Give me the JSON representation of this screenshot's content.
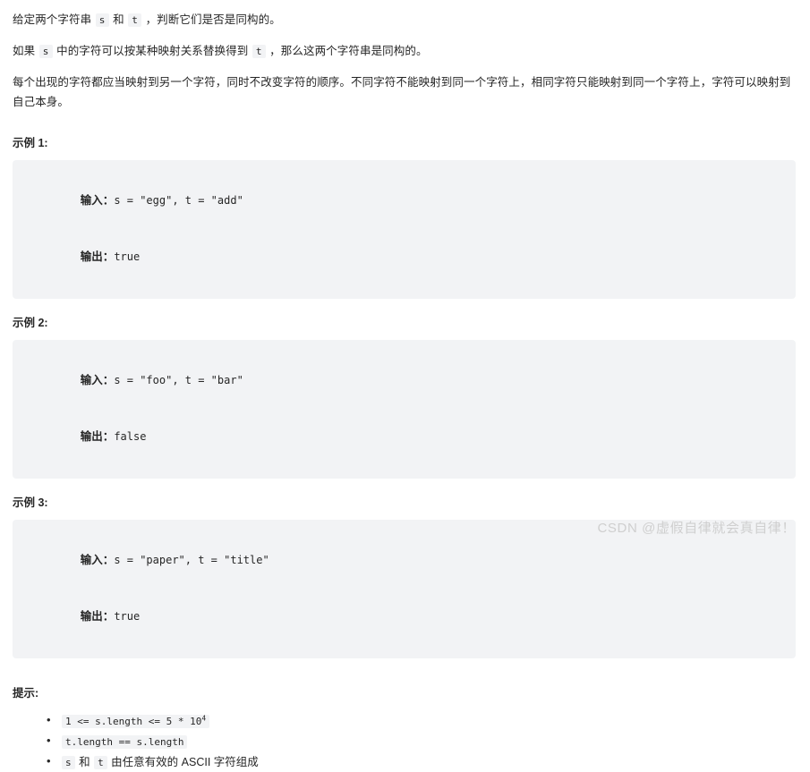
{
  "description": {
    "paragraphs": [
      {
        "parts": [
          {
            "type": "text",
            "value": "给定两个字符串 "
          },
          {
            "type": "code",
            "value": "s"
          },
          {
            "type": "text",
            "value": " 和 "
          },
          {
            "type": "code",
            "value": "t"
          },
          {
            "type": "text",
            "value": " ，判断它们是否是同构的。"
          }
        ]
      },
      {
        "parts": [
          {
            "type": "text",
            "value": "如果 "
          },
          {
            "type": "code",
            "value": "s"
          },
          {
            "type": "text",
            "value": " 中的字符可以按某种映射关系替换得到 "
          },
          {
            "type": "code",
            "value": "t"
          },
          {
            "type": "text",
            "value": " ，那么这两个字符串是同构的。"
          }
        ]
      },
      {
        "parts": [
          {
            "type": "text",
            "value": "每个出现的字符都应当映射到另一个字符，同时不改变字符的顺序。不同字符不能映射到同一个字符上，相同字符只能映射到同一个字符上，字符可以映射到自己本身。"
          }
        ]
      }
    ]
  },
  "examples": [
    {
      "title": "示例 1:",
      "input_label": "输入：",
      "input_value": "s = \"egg\", t = \"add\"",
      "output_label": "输出：",
      "output_value": "true"
    },
    {
      "title": "示例 2:",
      "input_label": "输入：",
      "input_value": "s = \"foo\", t = \"bar\"",
      "output_label": "输出：",
      "output_value": "false"
    },
    {
      "title": "示例 3:",
      "input_label": "输入：",
      "input_value": "s = \"paper\", t = \"title\"",
      "output_label": "输出：",
      "output_value": "true"
    }
  ],
  "hints": {
    "title": "提示:",
    "items": [
      {
        "parts": [
          {
            "type": "code",
            "value": "1 <= s.length <= 5 * 10",
            "sup": "4"
          }
        ]
      },
      {
        "parts": [
          {
            "type": "code",
            "value": "t.length == s.length"
          }
        ]
      },
      {
        "parts": [
          {
            "type": "code",
            "value": "s"
          },
          {
            "type": "text",
            "value": " 和 "
          },
          {
            "type": "code",
            "value": "t"
          },
          {
            "type": "text",
            "value": " 由任意有效的 ASCII 字符组成"
          }
        ]
      }
    ]
  },
  "watermark": {
    "text": "CSDN @虚假自律就会真自律！"
  },
  "colors": {
    "code_bg": "#f2f3f5",
    "text": "#262626",
    "watermark": "#cfcfcf"
  }
}
